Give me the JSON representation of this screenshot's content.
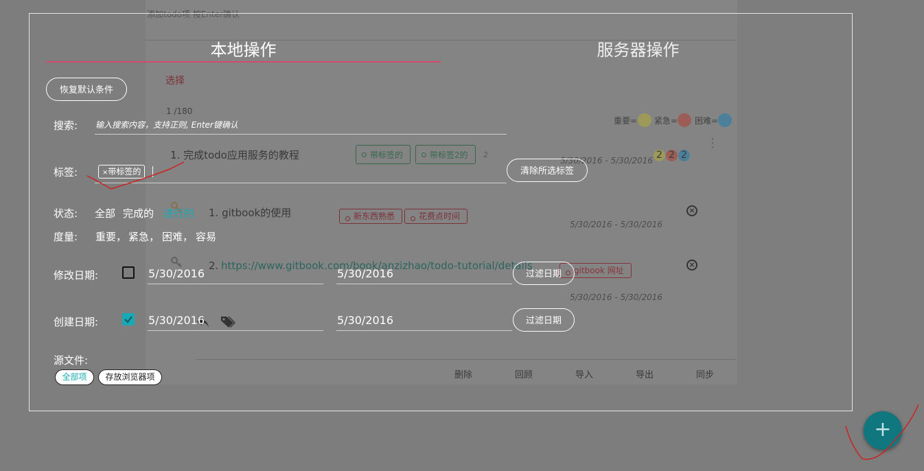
{
  "background": {
    "add_placeholder": "添加todo项 按Enter确认",
    "select_label": "选择",
    "page_counter": "1 /180",
    "legend": [
      {
        "label": "重要=",
        "color": "#a4a04b"
      },
      {
        "label": "紧急=",
        "color": "#a45049"
      },
      {
        "label": "困难=",
        "color": "#3a7ea1"
      }
    ],
    "todos": [
      {
        "title": "1. 完成todo应用服务的教程",
        "tags": [
          "带标签的",
          "带标签2的"
        ],
        "count": "2",
        "dates": "5/30/2016 - 5/30/2016",
        "badges": [
          "2",
          "2",
          "2"
        ]
      },
      {
        "title": "1. gitbook的使用",
        "tags": [
          "新东西熟悉",
          "花费点时间"
        ],
        "dates": "5/30/2016 - 5/30/2016",
        "child_title_prefix": "2. ",
        "child_link": "https://www.gitbook.com/book/anzizhao/todo-tutorial/details",
        "child_tag": "gitbook 网址",
        "child_dates": "5/30/2016 - 5/30/2016"
      }
    ],
    "footer_actions": [
      "删除",
      "回顾",
      "导入",
      "导出",
      "同步"
    ]
  },
  "modal": {
    "tabs": [
      "本地操作",
      "服务器操作"
    ],
    "reset_button": "恢复默认条件",
    "search_label": "搜索:",
    "search_placeholder": "输入搜索内容，支持正则, Enter键确认",
    "tags_label": "标签:",
    "selected_tag": "带标签的",
    "clear_tags_button": "清除所选标签",
    "status_label": "状态:",
    "status_options": [
      "全部",
      "完成的",
      "进行的"
    ],
    "measure_label": "度量:",
    "measure_options": [
      "重要，",
      "紧急，",
      "困难，",
      "容易"
    ],
    "modify_date_label": "修改日期:",
    "modify_from": "5/30/2016",
    "modify_to": "5/30/2016",
    "create_date_label": "创建日期:",
    "create_from": "5/30/2016",
    "create_to": "5/30/2016",
    "filter_date_button": "过滤日期",
    "source_label": "源文件:",
    "source_options": [
      "全部项",
      "存放浏览器项"
    ]
  },
  "fab_symbol": "+"
}
